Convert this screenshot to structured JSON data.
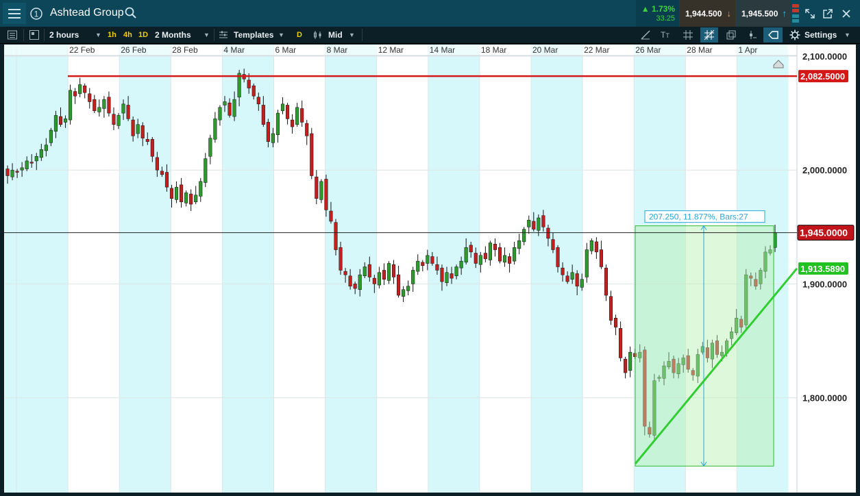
{
  "app": {
    "title": "Ashtead Group",
    "change_percent": "1.73%",
    "change_abs": "33.25",
    "sell_price": "1,944.500",
    "buy_price": "1,945.500"
  },
  "toolbar": {
    "interval": "2 hours",
    "quick_1h": "1h",
    "quick_4h": "4h",
    "quick_1d": "1D",
    "range": "2 Months",
    "templates": "Templates",
    "d_label": "D",
    "price_type": "Mid",
    "settings": "Settings"
  },
  "icons": {
    "menu": "hamburger-menu-icon",
    "counter": "circled-1-icon",
    "search": "search-icon",
    "up_arrow": "up-triangle-icon",
    "sell_arrow": "down-arrow-icon",
    "buy_arrow": "up-arrow-icon",
    "expand": "expand-icon",
    "popout": "popout-icon",
    "close": "close-icon"
  },
  "colors": {
    "header_bg": "#0c4658",
    "toolbar_bg": "#0c1f27",
    "weekend_shade": "#d6f8fb",
    "up_candle": "#2e9a2e",
    "down_candle": "#c21f1f",
    "resistance": "#d41717",
    "trendline": "#32cd32",
    "measure_border": "#2eba2e",
    "measure_fill": "#b5efb0"
  },
  "chart_data": {
    "type": "candlestick",
    "instrument": "Ashtead Group",
    "x_dates": [
      "22 Feb",
      "26 Feb",
      "28 Feb",
      "4 Mar",
      "6 Mar",
      "8 Mar",
      "12 Mar",
      "14 Mar",
      "18 Mar",
      "20 Mar",
      "22 Mar",
      "26 Mar",
      "28 Mar",
      "1 Apr"
    ],
    "y_ticks": [
      "2,100.0000",
      "2,000.0000",
      "1,900.0000",
      "1,800.0000"
    ],
    "ylim": [
      1720,
      2110
    ],
    "series": [
      {
        "name": "",
        "close": [
          1995,
          2000,
          1998,
          2002,
          2008,
          2006,
          2012,
          2018,
          2022,
          2035,
          2048,
          2040,
          2045,
          2070,
          2065,
          2075,
          2068,
          2060,
          2052,
          2055,
          2062,
          2050,
          2040,
          2048,
          2058,
          2045,
          2030,
          2040,
          2028,
          2025,
          2012,
          2000,
          1996,
          1985,
          1975,
          1985,
          1972,
          1980,
          1970,
          1978,
          1990,
          2010,
          2028,
          2045,
          2055,
          2060,
          2048,
          2062,
          2085,
          2080,
          2072,
          2065,
          2058,
          2040,
          2025,
          2032,
          2050,
          2058,
          2045,
          2038,
          2055,
          2042,
          2030,
          1995,
          1975,
          1990,
          1965,
          1955,
          1930,
          1912,
          1908,
          1898,
          1896,
          1908,
          1915,
          1906,
          1900,
          1910,
          1904,
          1918,
          1906,
          1890,
          1895,
          1898,
          1912,
          1920,
          1916,
          1925,
          1918,
          1912,
          1902,
          1910,
          1905,
          1915,
          1920,
          1932,
          1928,
          1918,
          1925,
          1922,
          1936,
          1930,
          1920,
          1925,
          1918,
          1932,
          1938,
          1948,
          1956,
          1948,
          1958,
          1950,
          1940,
          1930,
          1915,
          1908,
          1902,
          1910,
          1898,
          1904,
          1930,
          1938,
          1928,
          1915,
          1890,
          1868,
          1862,
          1835,
          1822,
          1840,
          1836,
          1840,
          1775,
          1768,
          1815,
          1818,
          1828,
          1832,
          1822,
          1830,
          1835,
          1825,
          1820,
          1838,
          1845,
          1835,
          1848,
          1838,
          1840,
          1850,
          1858,
          1870,
          1862,
          1908,
          1905,
          1898,
          1912,
          1928,
          1930,
          1945
        ]
      }
    ],
    "resistance_level": 2082.5,
    "resistance_label": "2,082.5000",
    "current_price": 1945.0,
    "current_price_label": "1,945.0000",
    "trendline_value": 1913.589,
    "trendline_label": "1,913.5890",
    "measure_label": "207.250, 11.877%, Bars:27",
    "grid": true,
    "weekend_shading": true
  }
}
